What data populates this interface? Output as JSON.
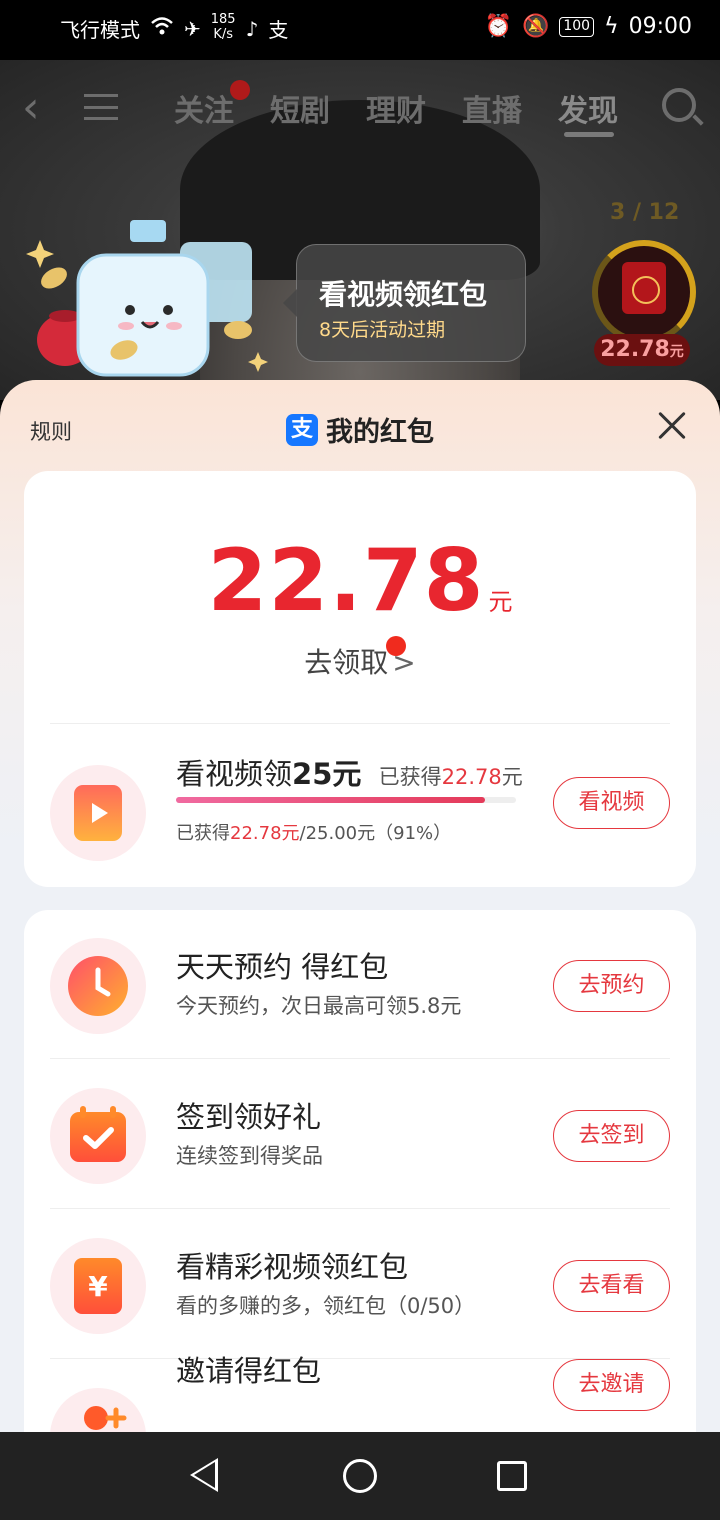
{
  "status_bar": {
    "mode": "飞行模式",
    "speed_value": "185",
    "speed_unit": "K/s",
    "battery": "100",
    "time": "09:00"
  },
  "top_nav": {
    "tabs": [
      {
        "label": "关注"
      },
      {
        "label": "短剧"
      },
      {
        "label": "理财"
      },
      {
        "label": "直播"
      },
      {
        "label": "发现"
      }
    ],
    "active_tab": "发现"
  },
  "promo": {
    "bubble_title": "看视频领红包",
    "bubble_sub": "8天后活动过期",
    "counter": "3 / 12",
    "redpack_amount": "22.78",
    "redpack_unit": "元"
  },
  "sheet": {
    "rules": "规则",
    "title": "我的红包",
    "alipay_char": "支"
  },
  "balance": {
    "amount": "22.78",
    "unit": "元",
    "claim_label": "去领取",
    "claim_chevron": ">"
  },
  "watch_task": {
    "title_prefix": "看视频领",
    "title_amount": "25元",
    "earned_prefix": "已获得",
    "earned_amount": "22.78",
    "earned_unit": "元",
    "progress_prefix": "已获得",
    "progress_earned": "22.78元",
    "progress_total": "/25.00元（91%）",
    "progress_fraction": 0.91,
    "button": "看视频"
  },
  "tasks": [
    {
      "title": "天天预约 得红包",
      "sub": "今天预约，次日最高可领5.8元",
      "button": "去预约",
      "icon": "clock-icon"
    },
    {
      "title": "签到领好礼",
      "sub": "连续签到得奖品",
      "button": "去签到",
      "icon": "calendar-check-icon"
    },
    {
      "title": "看精彩视频领红包",
      "sub": "看的多赚的多，领红包（0/50）",
      "button": "去看看",
      "icon": "yuan-icon"
    },
    {
      "title": "邀请得红包",
      "sub": "",
      "button": "去邀请",
      "icon": "invite-icon"
    }
  ],
  "colors": {
    "accent_red": "#e5383f",
    "amount_red": "#e8262f",
    "alipay_blue": "#1677ff"
  }
}
